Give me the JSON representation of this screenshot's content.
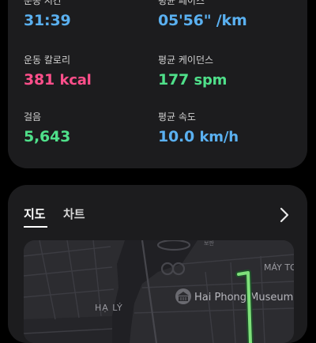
{
  "stats": {
    "duration": {
      "label": "운동 시간",
      "value": "31:39",
      "color": "#5ab0f0"
    },
    "pace": {
      "label": "평균 페이스",
      "value": "05'56\" /km",
      "color": "#5ab0f0"
    },
    "calories": {
      "label": "운동 칼로리",
      "value": "381",
      "unit": "kcal",
      "color": "#ff4f8b"
    },
    "cadence": {
      "label": "평균 케이던스",
      "value": "177",
      "unit": "spm",
      "color": "#4fe08a"
    },
    "steps": {
      "label": "걸음",
      "value": "5,643",
      "color": "#4fe08a"
    },
    "speed": {
      "label": "평균 속도",
      "value": "10.0",
      "unit": "km/h",
      "color": "#5ab0f0"
    }
  },
  "map_card": {
    "tabs": [
      {
        "label": "지도",
        "active": true
      },
      {
        "label": "차트",
        "active": false
      }
    ],
    "map": {
      "labels": {
        "ha_ly": "HẠ LÝ",
        "may_to": "MÁY TƠ",
        "museum": "Hai Phong Museum",
        "small": "보판"
      },
      "route_color": "#7ee07a"
    }
  }
}
